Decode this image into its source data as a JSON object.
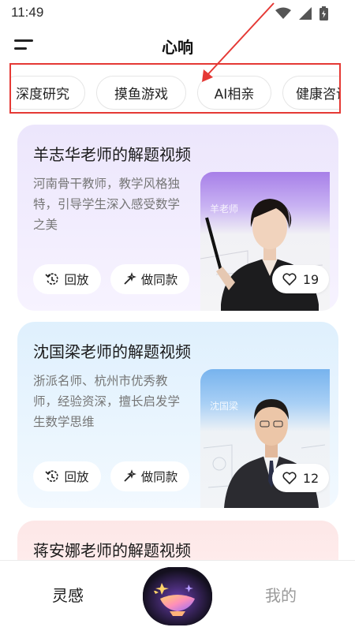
{
  "status_bar": {
    "time": "11:49"
  },
  "header": {
    "title": "心响"
  },
  "categories": [
    {
      "label": "深度研究"
    },
    {
      "label": "摸鱼游戏"
    },
    {
      "label": "AI相亲"
    },
    {
      "label": "健康咨询"
    }
  ],
  "cards": [
    {
      "title": "羊志华老师的解题视频",
      "description": "河南骨干教师，教学风格独特，引导学生深入感受数学之美",
      "thumbnail_label": "羊老师",
      "replay_label": "回放",
      "copy_label": "做同款",
      "likes": "19"
    },
    {
      "title": "沈国梁老师的解题视频",
      "description": "浙派名师、杭州市优秀教师，经验资深，擅长启发学生数学思维",
      "thumbnail_label": "沈国梁",
      "replay_label": "回放",
      "copy_label": "做同款",
      "likes": "12"
    },
    {
      "title": "蒋安娜老师的解题视频"
    }
  ],
  "bottom_nav": {
    "inspiration": "灵感",
    "mine": "我的"
  },
  "colors": {
    "highlight_box": "#e53935",
    "card1_bg": "#ece6fc",
    "card2_bg": "#dff0fd",
    "card3_bg": "#fde7e7"
  }
}
